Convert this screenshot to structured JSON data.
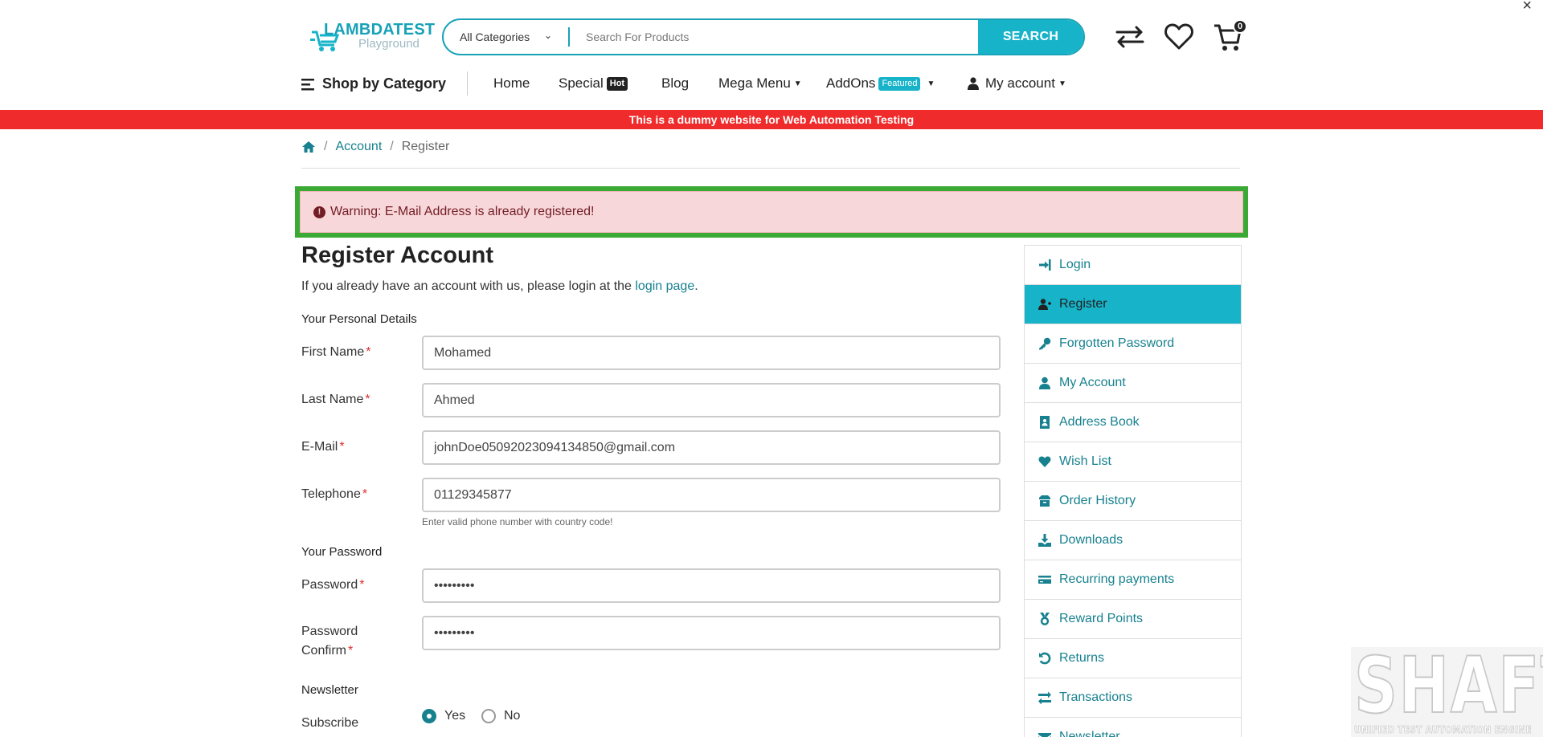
{
  "window": {
    "close_glyph": "×"
  },
  "header": {
    "logo_brand": "LAMBDATEST",
    "logo_sub": "Playground",
    "category_select": "All Categories",
    "search_placeholder": "Search For Products",
    "search_button": "SEARCH",
    "cart_count": "0"
  },
  "nav": {
    "shop_by_category": "Shop by Category",
    "home": "Home",
    "special": "Special",
    "special_tag": "Hot",
    "blog": "Blog",
    "mega_menu": "Mega Menu",
    "addons": "AddOns",
    "addons_tag": "Featured",
    "my_account": "My account"
  },
  "banner": "This is a dummy website for Web Automation Testing",
  "breadcrumb": {
    "account": "Account",
    "register": "Register",
    "sep": "/"
  },
  "alert": {
    "message": "Warning: E-Mail Address is already registered!"
  },
  "page": {
    "title": "Register Account",
    "intro_text": "If you already have an account with us, please login at the ",
    "intro_link": "login page",
    "intro_end": "."
  },
  "form": {
    "personal_legend": "Your Personal Details",
    "first_name_label": "First Name",
    "first_name_value": "Mohamed",
    "last_name_label": "Last Name",
    "last_name_value": "Ahmed",
    "email_label": "E-Mail",
    "email_value": "johnDoe05092023094134850@gmail.com",
    "telephone_label": "Telephone",
    "telephone_value": "01129345877",
    "telephone_help": "Enter valid phone number with country code!",
    "password_legend": "Your Password",
    "password_label": "Password",
    "password_value": "passworde",
    "confirm_label_1": "Password",
    "confirm_label_2": "Confirm",
    "confirm_value": "passworde",
    "newsletter_legend": "Newsletter",
    "subscribe_label": "Subscribe",
    "yes_label": "Yes",
    "no_label": "No",
    "required_mark": "*"
  },
  "sidebar": {
    "items": [
      {
        "label": "Login",
        "icon": "sign-in-icon"
      },
      {
        "label": "Register",
        "icon": "user-plus-icon"
      },
      {
        "label": "Forgotten Password",
        "icon": "key-icon"
      },
      {
        "label": "My Account",
        "icon": "user-icon"
      },
      {
        "label": "Address Book",
        "icon": "address-book-icon"
      },
      {
        "label": "Wish List",
        "icon": "heart-icon"
      },
      {
        "label": "Order History",
        "icon": "box-icon"
      },
      {
        "label": "Downloads",
        "icon": "download-icon"
      },
      {
        "label": "Recurring payments",
        "icon": "credit-card-icon"
      },
      {
        "label": "Reward Points",
        "icon": "medal-icon"
      },
      {
        "label": "Returns",
        "icon": "undo-icon"
      },
      {
        "label": "Transactions",
        "icon": "exchange-icon"
      },
      {
        "label": "Newsletter",
        "icon": "envelope-icon"
      }
    ]
  },
  "watermark": {
    "big": "SHAFT",
    "small": "UNIFIED TEST AUTOMATION ENGINE"
  },
  "colors": {
    "accent": "#17b3c9",
    "link": "#17818f",
    "banner": "#f02b2b",
    "alert_border": "#3aaa35"
  }
}
